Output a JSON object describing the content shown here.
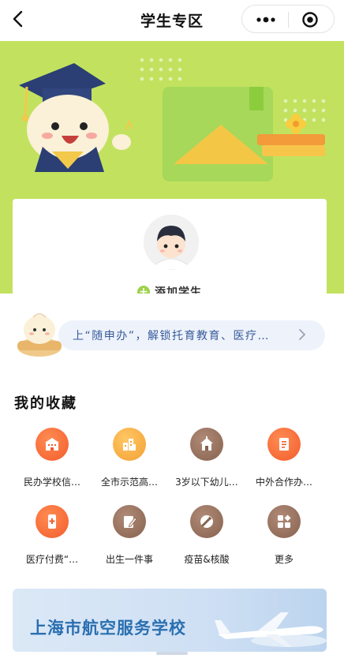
{
  "header": {
    "title": "学生专区"
  },
  "card": {
    "add_label": "添加学生"
  },
  "notice": {
    "text": "上“随申办”，解锁托育教育、医疗…"
  },
  "favorites": {
    "title": "我的收藏",
    "items": [
      {
        "label": "民办学校信…",
        "icon": "school-building-icon"
      },
      {
        "label": "全市示范高…",
        "icon": "city-buildings-icon"
      },
      {
        "label": "3岁以下幼儿…",
        "icon": "house-icon"
      },
      {
        "label": "中外合作办…",
        "icon": "document-icon"
      },
      {
        "label": "医疗付费“…",
        "icon": "medical-phone-icon"
      },
      {
        "label": "出生一件事",
        "icon": "pen-paper-icon"
      },
      {
        "label": "疫苗&核酸",
        "icon": "vaccine-icon"
      },
      {
        "label": "更多",
        "icon": "grid-more-icon"
      }
    ]
  },
  "school_banner": {
    "name": "上海市航空服务学校"
  },
  "colors": {
    "banner_green": "#c2e25f",
    "accent_orange": "#f25c2d",
    "accent_amber": "#f3a033",
    "accent_brown": "#86624f",
    "school_blue": "#2a6fb0"
  }
}
